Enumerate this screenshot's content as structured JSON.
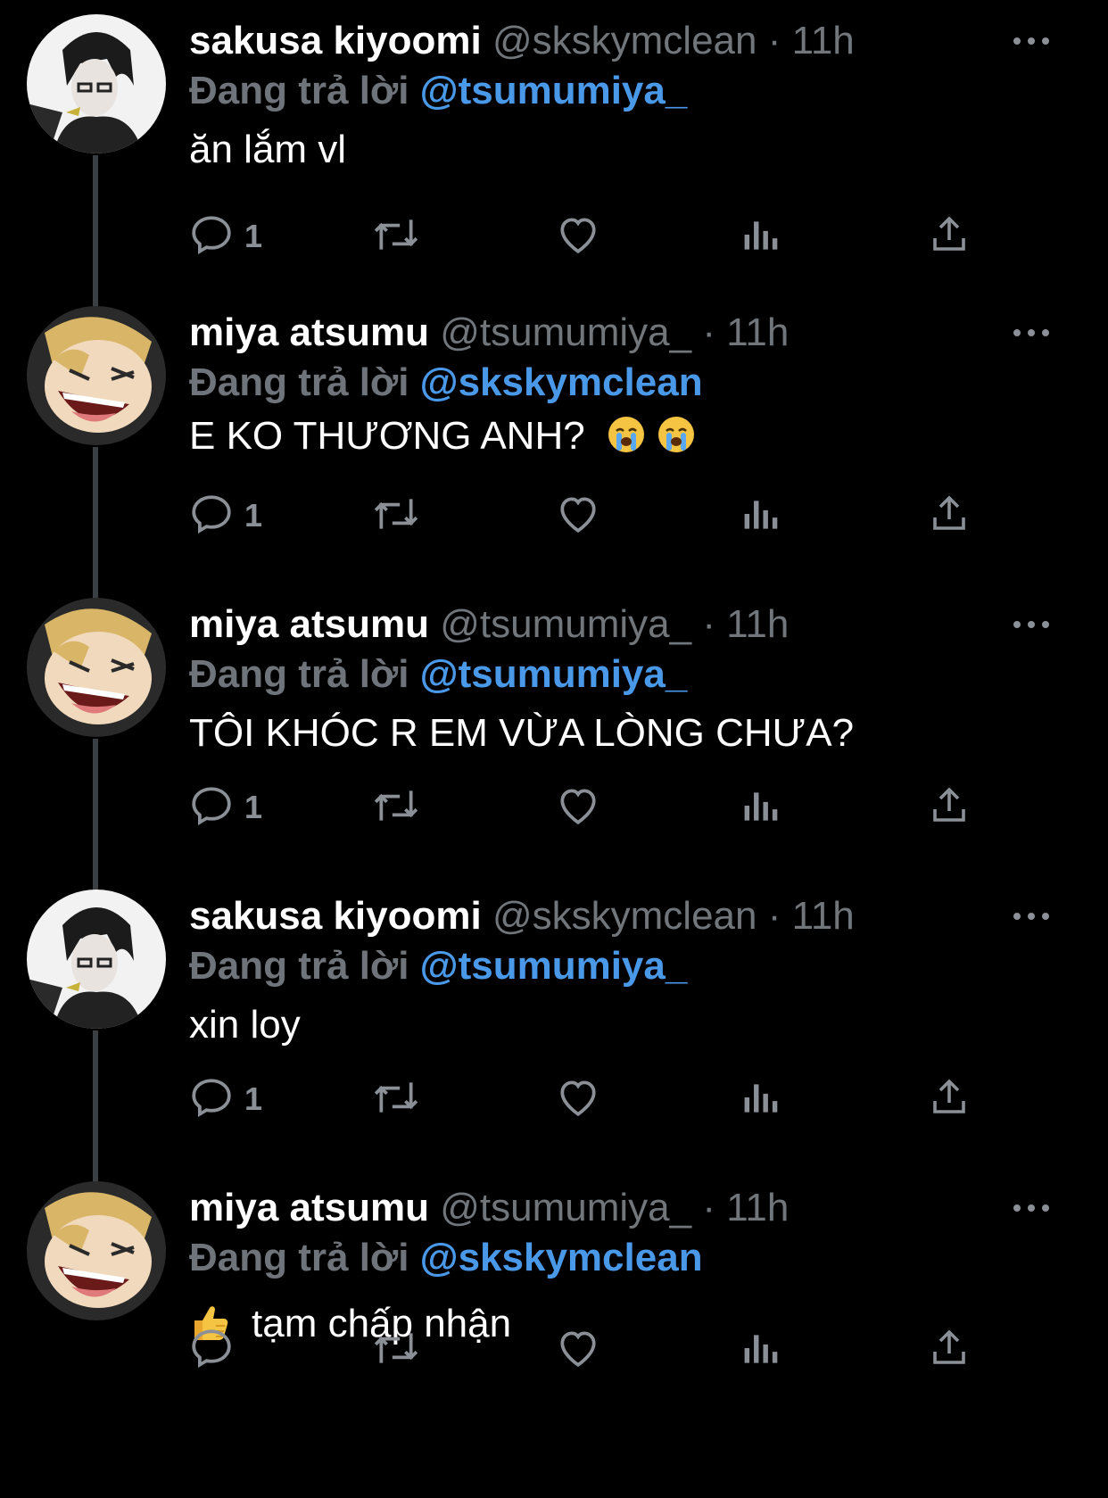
{
  "reply_prefix": "Đang trả lời",
  "separator": "·",
  "tweets": [
    {
      "name": "sakusa kiyoomi",
      "handle": "@skskymclean",
      "time": "11h",
      "reply_to": "@tsumumiya_",
      "text": "ăn lắm vl",
      "reply_count": "1",
      "avatar": "sakusa-avatar"
    },
    {
      "name": "miya atsumu",
      "handle": "@tsumumiya_",
      "time": "11h",
      "reply_to": "@skskymclean",
      "text": "E KO THƯƠNG ANH?",
      "reply_count": "1",
      "avatar": "atsumu-avatar",
      "emojis": [
        "crying-face-icon",
        "crying-face-icon"
      ]
    },
    {
      "name": "miya atsumu",
      "handle": "@tsumumiya_",
      "time": "11h",
      "reply_to": "@tsumumiya_",
      "text": "TÔI KHÓC R EM VỪA LÒNG CHƯA?",
      "reply_count": "1",
      "avatar": "atsumu-avatar"
    },
    {
      "name": "sakusa kiyoomi",
      "handle": "@skskymclean",
      "time": "11h",
      "reply_to": "@tsumumiya_",
      "text": "xin loy",
      "reply_count": "1",
      "avatar": "sakusa-avatar"
    },
    {
      "name": "miya atsumu",
      "handle": "@tsumumiya_",
      "time": "11h",
      "reply_to": "@skskymclean",
      "text": "tạm chấp nhận",
      "reply_count": "",
      "avatar": "atsumu-avatar",
      "leading_emoji": "thumbs-up-icon"
    }
  ],
  "colors": {
    "background": "#000000",
    "mention": "#4a99e9",
    "secondary": "#71767b",
    "thread_line": "#3a3f44"
  }
}
